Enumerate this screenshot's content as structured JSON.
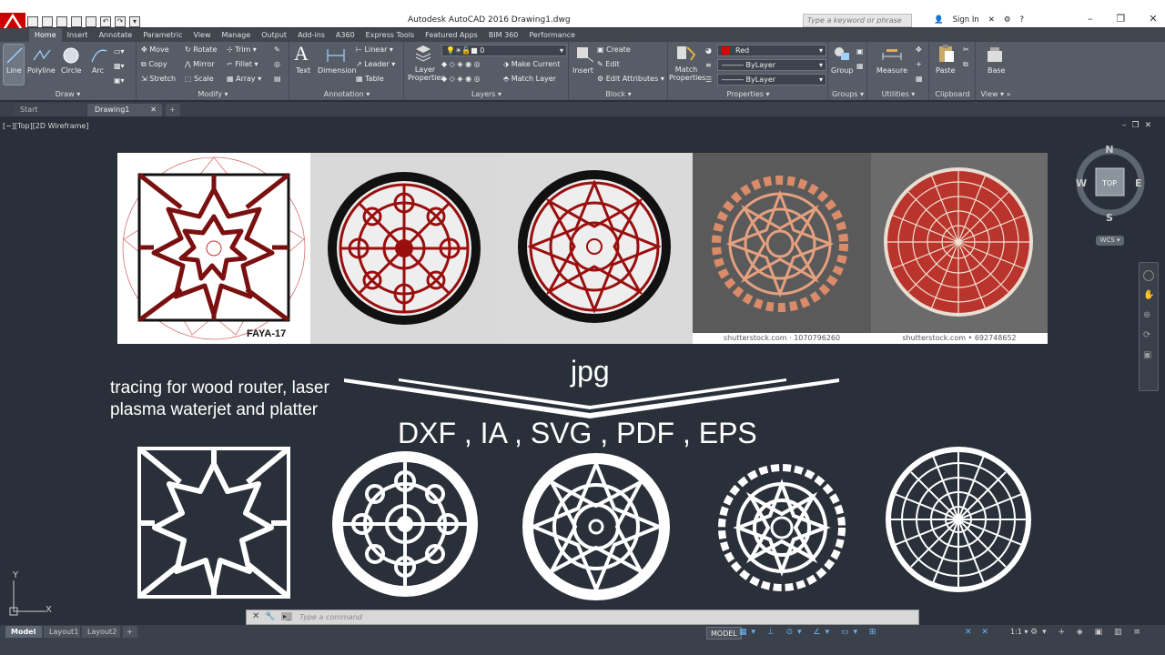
{
  "titlebar": {
    "app_title": "Autodesk AutoCAD 2016    Drawing1.dwg",
    "search_placeholder": "Type a keyword or phrase",
    "signin_label": "Sign In"
  },
  "ribbon_tabs": [
    "Home",
    "Insert",
    "Annotate",
    "Parametric",
    "View",
    "Manage",
    "Output",
    "Add-ins",
    "A360",
    "Express Tools",
    "Featured Apps",
    "BIM 360",
    "Performance"
  ],
  "ribbon": {
    "draw": {
      "title": "Draw",
      "line": "Line",
      "polyline": "Polyline",
      "circle": "Circle",
      "arc": "Arc"
    },
    "modify": {
      "title": "Modify",
      "move": "Move",
      "rotate": "Rotate",
      "trim": "Trim",
      "copy": "Copy",
      "mirror": "Mirror",
      "fillet": "Fillet",
      "stretch": "Stretch",
      "scale": "Scale",
      "array": "Array"
    },
    "annotation": {
      "title": "Annotation",
      "text": "Text",
      "dimension": "Dimension",
      "linear": "Linear",
      "leader": "Leader",
      "table": "Table"
    },
    "layers": {
      "title": "Layers",
      "layer_properties": "Layer Properties",
      "layer_value": "0",
      "make_current": "Make Current",
      "match_layer": "Match Layer"
    },
    "block": {
      "title": "Block",
      "insert": "Insert",
      "create": "Create",
      "edit": "Edit",
      "edit_attributes": "Edit Attributes"
    },
    "properties": {
      "title": "Properties",
      "match_properties": "Match Properties",
      "color": "Red",
      "linetype": "ByLayer",
      "lineweight": "ByLayer",
      "color_hex": "#e00000"
    },
    "groups": {
      "title": "Groups",
      "group": "Group"
    },
    "utilities": {
      "title": "Utilities",
      "measure": "Measure"
    },
    "clipboard": {
      "title": "Clipboard",
      "paste": "Paste"
    },
    "view": {
      "title": "View",
      "base": "Base"
    }
  },
  "doc_tabs": {
    "start": "Start",
    "drawing": "Drawing1"
  },
  "viewport": {
    "label": "[−][Top][2D Wireframe]"
  },
  "viewcube": {
    "n": "N",
    "s": "S",
    "e": "E",
    "w": "W",
    "top": "TOP",
    "wcs": "WCS"
  },
  "content": {
    "image_label_1": "FAYA-17",
    "caption_4": "shutterstock.com · 1070796260",
    "caption_5": "shutterstock.com • 692748652",
    "tracing_line1": "tracing for wood router, laser",
    "tracing_line2": "plasma waterjet and platter",
    "jpg": "jpg",
    "formats": "DXF , IA , SVG , PDF , EPS"
  },
  "command": {
    "placeholder": "Type a command"
  },
  "status": {
    "model_tab": "Model",
    "layout1": "Layout1",
    "layout2": "Layout2",
    "model_button": "MODEL",
    "scale": "1:1"
  },
  "ucs": {
    "x": "X",
    "y": "Y"
  },
  "colors": {
    "canvas": "#2a3039",
    "ribbon": "#575d67",
    "accent_red": "#c8262a"
  }
}
